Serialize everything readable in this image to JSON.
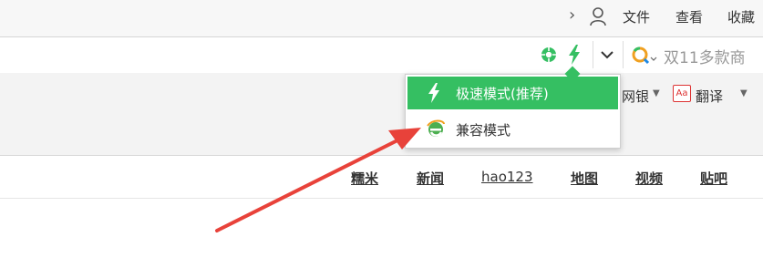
{
  "topbar": {
    "menu": [
      "文件",
      "查看",
      "收藏"
    ]
  },
  "addressbar": {
    "search_placeholder": "双11多款商"
  },
  "toolbar": {
    "bank_label": "网银",
    "translate_label": "翻译",
    "translate_icon_text": "Aa"
  },
  "mode_menu": {
    "items": [
      {
        "label": "极速模式(推荐)",
        "icon": "lightning-icon",
        "selected": true
      },
      {
        "label": "兼容模式",
        "icon": "ie-icon",
        "selected": false
      }
    ]
  },
  "page_nav": {
    "links": [
      "糯米",
      "新闻",
      "hao123",
      "地图",
      "视频",
      "贴吧"
    ]
  },
  "colors": {
    "accent_green": "#35bf62",
    "arrow_red": "#e8423a"
  }
}
